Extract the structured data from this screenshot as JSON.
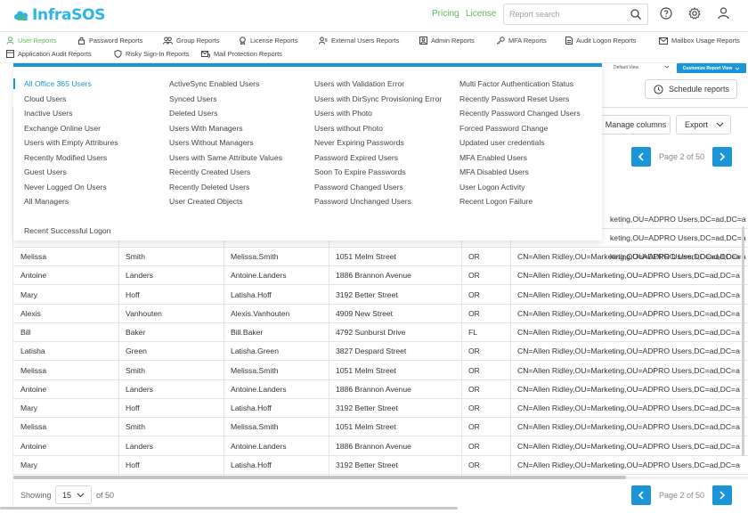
{
  "header": {
    "logo_text": "InfraSOS",
    "pricing": "Pricing",
    "license": "License",
    "search_placeholder": "Report search"
  },
  "report_nav": [
    {
      "label": "User Reports",
      "icon": "user-icon",
      "active": true
    },
    {
      "label": "Password Reports",
      "icon": "lock-icon"
    },
    {
      "label": "Group Reports",
      "icon": "group-icon"
    },
    {
      "label": "License Reports",
      "icon": "badge-icon"
    },
    {
      "label": "External Users Reports",
      "icon": "external-users-icon"
    },
    {
      "label": "Admin Reports",
      "icon": "admin-icon"
    },
    {
      "label": "MFA Reports",
      "icon": "key-icon"
    },
    {
      "label": "Audit Logon Reports",
      "icon": "document-icon"
    },
    {
      "label": "Mailbox Usage Reports",
      "icon": "mail-icon"
    },
    {
      "label": "Application Audit Reports",
      "icon": "app-icon"
    },
    {
      "label": "Risky Sign-In Reports",
      "icon": "shield-icon"
    },
    {
      "label": "Mail Protection Reports",
      "icon": "mail-shield-icon"
    }
  ],
  "controls": {
    "default_view": "Default View",
    "customize_view": "Customize Report View",
    "schedule_reports": "Schedule reports",
    "manage_columns": "Manage columns",
    "export": "Export",
    "page_text": "Page 2 of 50"
  },
  "menu": {
    "columns": [
      [
        "All Office 365 Users",
        "Cloud Users",
        "Inactive Users",
        "Exchange Online User",
        "Users with Empty Attribures",
        "Recently Modified Users",
        "Guest Users",
        "Never Logged On Users",
        "All Managers",
        "",
        "Recent Successful Logon"
      ],
      [
        "ActiveSync Enabled Users",
        "Synced Users",
        "Deleted Users",
        "Users With Managers",
        "Users Without Managers",
        "Users with Same Attribute Values",
        "Recently Created Users",
        "Recently Deleted Users",
        "User Created Objects"
      ],
      [
        "Users with Validation Error",
        "Users with DirSync Provisioning Error",
        "Users with Photo",
        "Users without Photo",
        "Never Expiring Passwords",
        "Password Expired Users",
        "Soon To Expire Passwords",
        "Password Changed Users",
        "Password Unchanged Users"
      ],
      [
        "Multi Factor Authentication Status",
        "Recently Password Reset Users",
        "Recently Password Changed Users",
        "Forced Password Change",
        "Updated user credentials",
        "MFA Enabled Users",
        "MFA Disabled Users",
        "User Logon Activity",
        "Recent Logon Failure"
      ]
    ]
  },
  "table": {
    "partial_rows": [
      "keting,OU=ADPRO Users,DC=ad,DC=a",
      "keting,OU=ADPRO Users,DC=ad,DC=a",
      "keting,OU=ADPRO Users,DC=ad,DC=a"
    ],
    "rows": [
      [
        "Melissa",
        "Smith",
        "Melissa.Smith",
        "1051 Melm Street",
        "OR",
        "CN=Allen Ridley,OU=Marketing,OU=ADPRO Users,DC=ad,DC=a"
      ],
      [
        "Antoine",
        "Landers",
        "Antoine.Landers",
        "1886 Brannon Avenue",
        "OR",
        "CN=Allen Ridley,OU=Marketing,OU=ADPRO Users,DC=ad,DC=a"
      ],
      [
        "Mary",
        "Hoff",
        "Latisha.Hoff",
        "3192 Better Street",
        "OR",
        "CN=Allen Ridley,OU=Marketing,OU=ADPRO Users,DC=ad,DC=a"
      ],
      [
        "Alexis",
        "Vanhouten",
        "Alexis.Vanhouten",
        "4909 New Street",
        "OR",
        "CN=Allen Ridley,OU=Marketing,OU=ADPRO Users,DC=ad,DC=a"
      ],
      [
        "Bill",
        "Baker",
        "Bill.Baker",
        "4792 Sunburst Drive",
        "FL",
        "CN=Allen Ridley,OU=Marketing,OU=ADPRO Users,DC=ad,DC=a"
      ],
      [
        "Latisha",
        "Green",
        "Latisha.Green",
        "3827 Despard Street",
        "OR",
        "CN=Allen Ridley,OU=Marketing,OU=ADPRO Users,DC=ad,DC=a"
      ],
      [
        "Melissa",
        "Smith",
        "Melissa.Smith",
        "1051 Melm Street",
        "OR",
        "CN=Allen Ridley,OU=Marketing,OU=ADPRO Users,DC=ad,DC=a"
      ],
      [
        "Antoine",
        "Landers",
        "Antoine.Landers",
        "1886 Brannon Avenue",
        "OR",
        "CN=Allen Ridley,OU=Marketing,OU=ADPRO Users,DC=ad,DC=a"
      ],
      [
        "Mary",
        "Hoff",
        "Latisha.Hoff",
        "3192 Better Street",
        "OR",
        "CN=Allen Ridley,OU=Marketing,OU=ADPRO Users,DC=ad,DC=a"
      ],
      [
        "Melissa",
        "Smith",
        "Melissa.Smith",
        "1051 Melm Street",
        "OR",
        "CN=Allen Ridley,OU=Marketing,OU=ADPRO Users,DC=ad,DC=a"
      ],
      [
        "Antoine",
        "Landers",
        "Antoine.Landers",
        "1886 Brannon Avenue",
        "OR",
        "CN=Allen Ridley,OU=Marketing,OU=ADPRO Users,DC=ad,DC=a"
      ],
      [
        "Mary",
        "Hoff",
        "Latisha.Hoff",
        "3192 Better Street",
        "OR",
        "CN=Allen Ridley,OU=Marketing,OU=ADPRO Users,DC=ad,DC=a"
      ]
    ]
  },
  "footer": {
    "showing": "Showing",
    "per_page": "15",
    "of_total": "of 50",
    "page_text": "Page 2 of 50"
  },
  "colors": {
    "accent_blue": "#1a96d8",
    "accent_green": "#5cb85c",
    "logo_blue": "#2bb5e8"
  }
}
